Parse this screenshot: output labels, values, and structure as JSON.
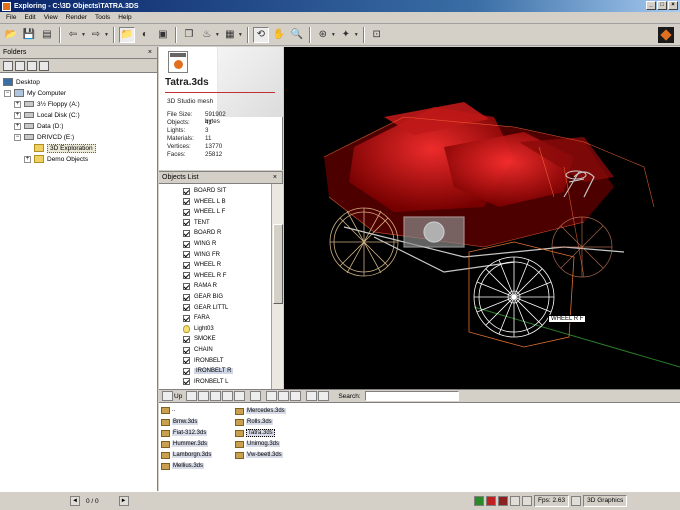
{
  "window": {
    "title": "Exploring - C:\\3D Objects\\TATRA.3DS"
  },
  "menu": [
    "File",
    "Edit",
    "View",
    "Render",
    "Tools",
    "Help"
  ],
  "folders_pane": {
    "title": "Folders",
    "close": "×",
    "tree": [
      {
        "label": "Desktop",
        "icon": "desktop-icon"
      },
      {
        "label": "My Computer",
        "icon": "computer-icon",
        "expander": "−"
      },
      {
        "label": "3½ Floppy (A:)",
        "icon": "floppy-icon",
        "expander": "+"
      },
      {
        "label": "Local Disk (C:)",
        "icon": "drive-icon",
        "expander": "+"
      },
      {
        "label": "Data (D:)",
        "icon": "drive-icon",
        "expander": "+"
      },
      {
        "label": "DRIVCD (E:)",
        "icon": "cd-icon",
        "expander": "−"
      },
      {
        "label": "3D Exploration",
        "icon": "folder-icon",
        "selected": true
      },
      {
        "label": "Demo Objects",
        "icon": "folder-icon",
        "expander": "+"
      }
    ]
  },
  "info": {
    "filename": "Tatra.3ds",
    "type": "3D Studio mesh",
    "stats": [
      {
        "label": "File Size:",
        "value": "591902 bytes"
      },
      {
        "label": "Objects:",
        "value": "41"
      },
      {
        "label": "Lights:",
        "value": "3"
      },
      {
        "label": "Materials:",
        "value": "11"
      },
      {
        "label": "Vertices:",
        "value": "13770"
      },
      {
        "label": "Faces:",
        "value": "25812"
      }
    ]
  },
  "objects_list": {
    "title": "Objects List",
    "close": "×",
    "items": [
      {
        "label": "BOARD SIT",
        "kind": "checkbox"
      },
      {
        "label": "WHEEL L B",
        "kind": "checkbox"
      },
      {
        "label": "WHEEL L F",
        "kind": "checkbox"
      },
      {
        "label": "TENT",
        "kind": "checkbox"
      },
      {
        "label": "BOARD R",
        "kind": "checkbox"
      },
      {
        "label": "WING R",
        "kind": "checkbox"
      },
      {
        "label": "WING FR",
        "kind": "checkbox"
      },
      {
        "label": "WHEEL R",
        "kind": "checkbox"
      },
      {
        "label": "WHEEL R F",
        "kind": "checkbox"
      },
      {
        "label": "RAMA R",
        "kind": "checkbox"
      },
      {
        "label": "GEAR BIG",
        "kind": "checkbox"
      },
      {
        "label": "GEAR LITTL",
        "kind": "checkbox"
      },
      {
        "label": "FARA",
        "kind": "checkbox"
      },
      {
        "label": "Light03",
        "kind": "light"
      },
      {
        "label": "SMOKE",
        "kind": "checkbox"
      },
      {
        "label": "CHAIN",
        "kind": "checkbox"
      },
      {
        "label": "IRONBELT",
        "kind": "checkbox"
      },
      {
        "label": "IRONBELT R",
        "kind": "checkbox",
        "highlighted": true
      },
      {
        "label": "IRONBELT L",
        "kind": "checkbox"
      }
    ]
  },
  "viewport": {
    "tooltip": "WHEEL R F"
  },
  "file_toolbar": {
    "up_label": "Up",
    "search_label": "Search:",
    "search_value": ""
  },
  "file_list": {
    "parent": "..",
    "files": [
      "Bmw.3ds",
      "Fiat-312.3ds",
      "Hummer.3ds",
      "Lamborgn.3ds",
      "Mellius.3ds",
      "Mercedes.3ds",
      "Rolls.3ds",
      "Tatra.3ds",
      "Unimog.3ds",
      "Vw-beetl.3ds"
    ],
    "selected": "Tatra.3ds"
  },
  "status": {
    "page": "0 / 0",
    "fps": "Fps: 2.63",
    "mode": "3D Graphics"
  },
  "colors": {
    "titlebar": "#0a246a",
    "chrome": "#d4d0c8",
    "viewport_bg": "#000000",
    "accent": "#e07020"
  }
}
